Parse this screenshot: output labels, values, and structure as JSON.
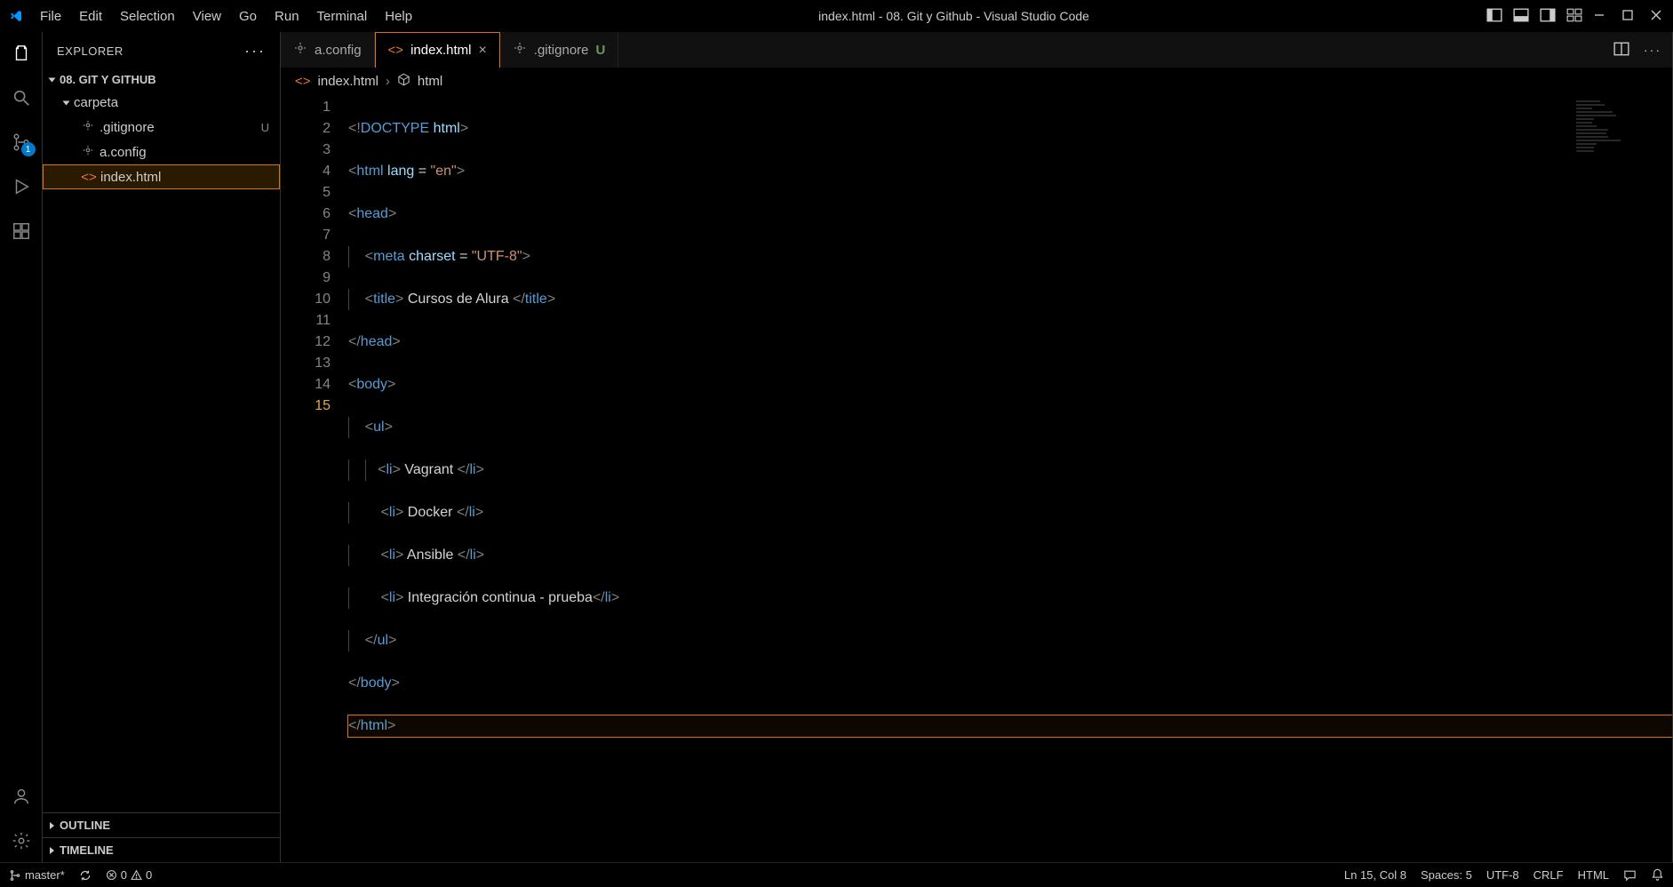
{
  "window": {
    "title": "index.html - 08. Git y Github - Visual Studio Code"
  },
  "menu": [
    "File",
    "Edit",
    "Selection",
    "View",
    "Go",
    "Run",
    "Terminal",
    "Help"
  ],
  "sidebar": {
    "title": "EXPLORER",
    "root": "08. GIT Y GITHUB",
    "folder": "carpeta",
    "files": [
      {
        "name": ".gitignore",
        "status": "U"
      },
      {
        "name": "a.config",
        "status": ""
      },
      {
        "name": "index.html",
        "status": ""
      }
    ],
    "outline": "OUTLINE",
    "timeline": "TIMELINE"
  },
  "scm_badge": "1",
  "tabs": [
    {
      "name": "a.config",
      "icon": "gear",
      "active": false,
      "status": ""
    },
    {
      "name": "index.html",
      "icon": "code",
      "active": true,
      "status": ""
    },
    {
      "name": ".gitignore",
      "icon": "gear",
      "active": false,
      "status": "U"
    }
  ],
  "breadcrumb": {
    "file": "index.html",
    "symbol": "html"
  },
  "code": {
    "lines": 15,
    "active_line": 15
  },
  "statusbar": {
    "branch": "master*",
    "errors": "0",
    "warnings": "0",
    "position": "Ln 15, Col 8",
    "spaces": "Spaces: 5",
    "encoding": "UTF-8",
    "eol": "CRLF",
    "lang": "HTML"
  }
}
